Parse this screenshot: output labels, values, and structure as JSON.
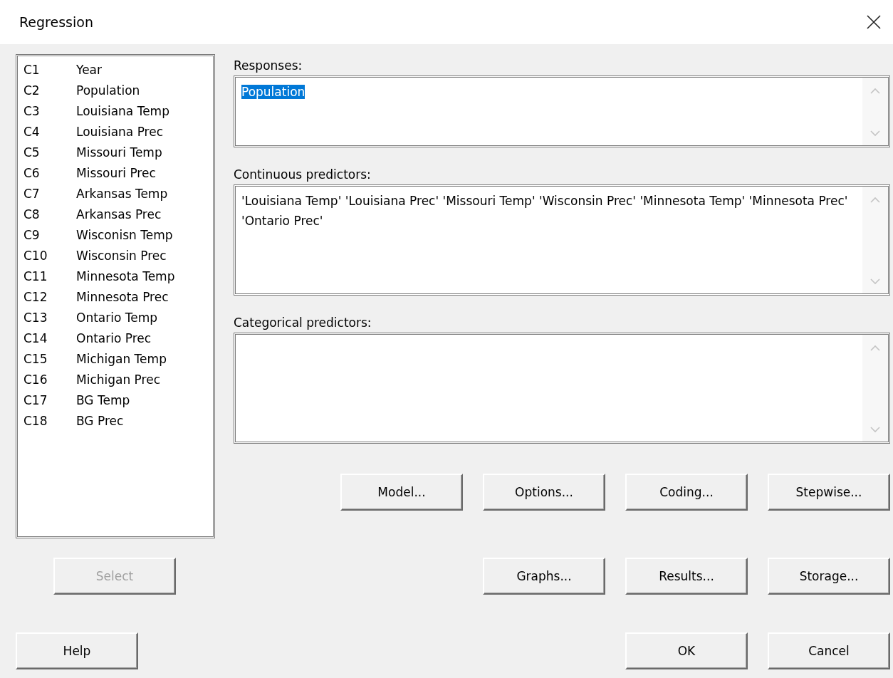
{
  "window": {
    "title": "Regression"
  },
  "columns": [
    {
      "id": "C1",
      "name": "Year"
    },
    {
      "id": "C2",
      "name": "Population"
    },
    {
      "id": "C3",
      "name": "Louisiana Temp"
    },
    {
      "id": "C4",
      "name": "Louisiana Prec"
    },
    {
      "id": "C5",
      "name": "Missouri Temp"
    },
    {
      "id": "C6",
      "name": "Missouri Prec"
    },
    {
      "id": "C7",
      "name": "Arkansas Temp"
    },
    {
      "id": "C8",
      "name": "Arkansas Prec"
    },
    {
      "id": "C9",
      "name": "Wisconisn Temp"
    },
    {
      "id": "C10",
      "name": "Wisconsin Prec"
    },
    {
      "id": "C11",
      "name": "Minnesota Temp"
    },
    {
      "id": "C12",
      "name": "Minnesota Prec"
    },
    {
      "id": "C13",
      "name": "Ontario Temp"
    },
    {
      "id": "C14",
      "name": "Ontario Prec"
    },
    {
      "id": "C15",
      "name": "Michigan Temp"
    },
    {
      "id": "C16",
      "name": "Michigan Prec"
    },
    {
      "id": "C17",
      "name": "BG Temp"
    },
    {
      "id": "C18",
      "name": "BG Prec"
    }
  ],
  "fields": [
    {
      "label": "Responses:",
      "value": "Population",
      "selected": true
    },
    {
      "label": "Continuous predictors:",
      "value": "'Louisiana Temp' 'Louisiana Prec' 'Missouri Temp' 'Wisconsin Prec' 'Minnesota Temp' 'Minnesota Prec' 'Ontario Prec'",
      "selected": false
    },
    {
      "label": "Categorical predictors:"
    }
  ],
  "button_rows": [
    {
      "left": [],
      "right": [
        {
          "label": "Model...",
          "disabled": false
        },
        {
          "label": "Options...",
          "disabled": false
        },
        {
          "label": "Coding...",
          "disabled": false
        },
        {
          "label": "Stepwise...",
          "disabled": false
        }
      ]
    },
    {
      "left": [
        {
          "label": "Select",
          "disabled": true
        }
      ],
      "right": [
        {
          "label": "Graphs...",
          "disabled": false
        },
        {
          "label": "Results...",
          "disabled": false
        },
        {
          "label": "Storage...",
          "disabled": false
        }
      ]
    },
    {
      "left": [
        {
          "label": "Help",
          "disabled": false
        }
      ],
      "right": [
        {
          "label": "OK",
          "disabled": false
        },
        {
          "label": "Cancel",
          "disabled": false
        }
      ]
    }
  ]
}
